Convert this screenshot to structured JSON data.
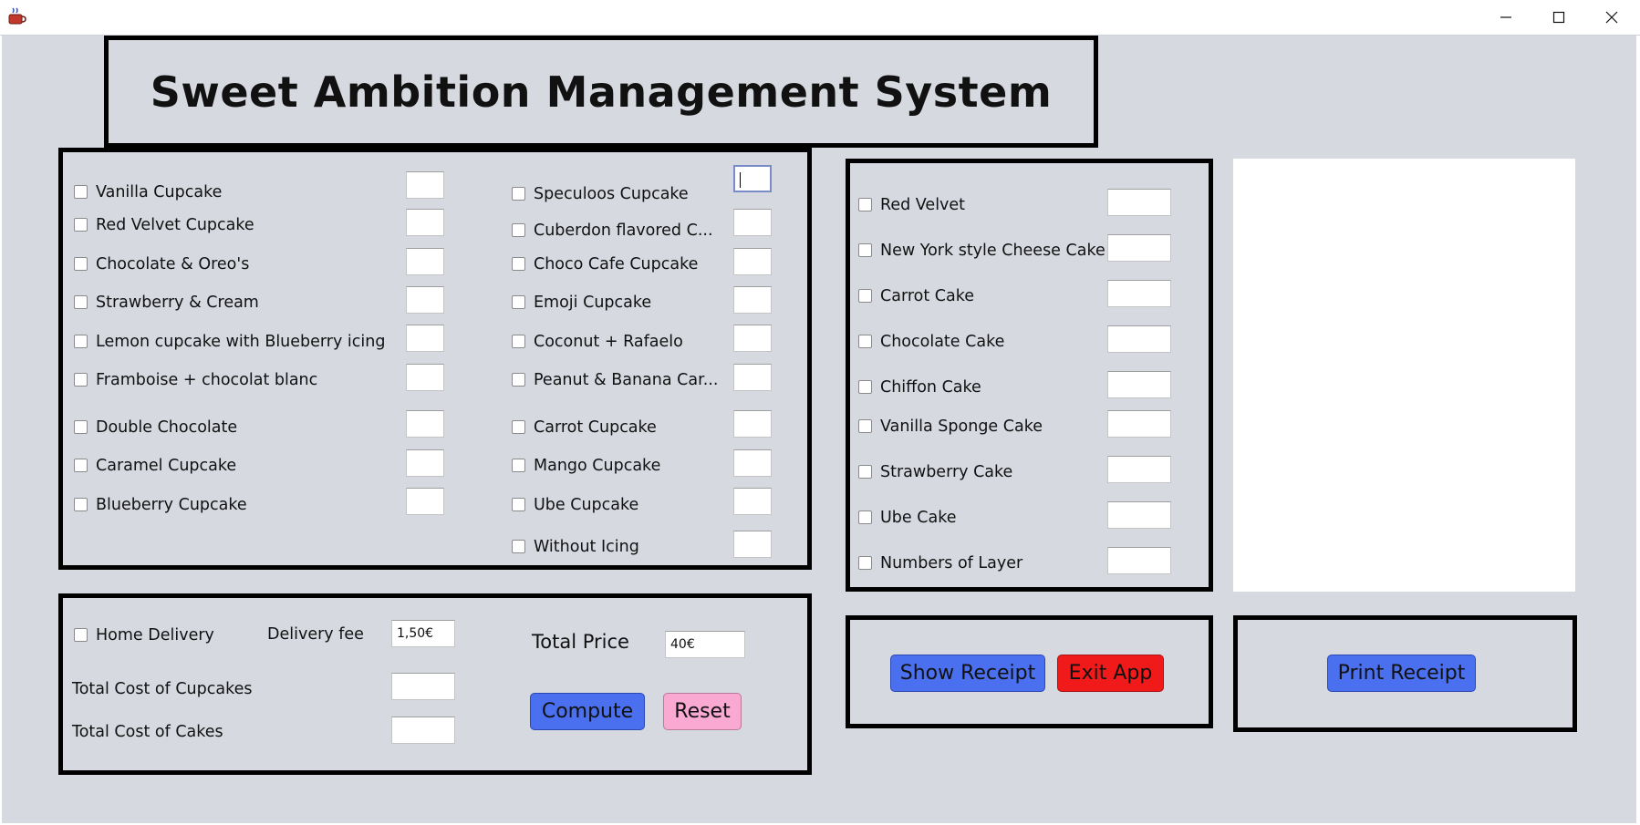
{
  "window": {
    "app_icon": "java-coffee-icon",
    "controls": [
      "minimize-icon",
      "maximize-icon",
      "close-icon"
    ]
  },
  "header": {
    "title": "Sweet Ambition Management System"
  },
  "cupcakes": {
    "left": [
      {
        "label": "Vanilla Cupcake",
        "qty": ""
      },
      {
        "label": "Red Velvet Cupcake",
        "qty": ""
      },
      {
        "label": "Chocolate & Oreo's",
        "qty": ""
      },
      {
        "label": "Strawberry & Cream",
        "qty": ""
      },
      {
        "label": "Lemon cupcake with Blueberry icing",
        "qty": ""
      },
      {
        "label": "Framboise + chocolat blanc",
        "qty": ""
      },
      {
        "label": "Double Chocolate",
        "qty": ""
      },
      {
        "label": "Caramel Cupcake",
        "qty": ""
      },
      {
        "label": "Blueberry Cupcake",
        "qty": ""
      }
    ],
    "right": [
      {
        "label": "Speculoos Cupcake",
        "qty": ""
      },
      {
        "label": "Cuberdon flavored C...",
        "qty": ""
      },
      {
        "label": "Choco Cafe Cupcake",
        "qty": ""
      },
      {
        "label": "Emoji Cupcake",
        "qty": ""
      },
      {
        "label": "Coconut + Rafaelo",
        "qty": ""
      },
      {
        "label": "Peanut & Banana Car...",
        "qty": ""
      },
      {
        "label": "Carrot Cupcake",
        "qty": ""
      },
      {
        "label": "Mango Cupcake",
        "qty": ""
      },
      {
        "label": "Ube Cupcake",
        "qty": ""
      },
      {
        "label": "Without Icing",
        "qty": ""
      }
    ]
  },
  "cakes": [
    {
      "label": "Red Velvet",
      "qty": ""
    },
    {
      "label": "New York style Cheese Cake",
      "qty": ""
    },
    {
      "label": "Carrot Cake",
      "qty": ""
    },
    {
      "label": "Chocolate Cake",
      "qty": ""
    },
    {
      "label": "Chiffon Cake",
      "qty": ""
    },
    {
      "label": "Vanilla Sponge Cake",
      "qty": ""
    },
    {
      "label": "Strawberry Cake",
      "qty": ""
    },
    {
      "label": "Ube Cake",
      "qty": ""
    },
    {
      "label": "Numbers of Layer",
      "qty": ""
    }
  ],
  "totals": {
    "home_delivery_label": "Home Delivery",
    "delivery_fee_label": "Delivery fee",
    "delivery_fee_value": "1,50€",
    "total_price_label": "Total Price",
    "total_price_value": "40€",
    "cupcakes_cost_label": "Total Cost of Cupcakes",
    "cupcakes_cost_value": "",
    "cakes_cost_label": "Total Cost of Cakes",
    "cakes_cost_value": ""
  },
  "buttons": {
    "compute": "Compute",
    "reset": "Reset",
    "show_receipt": "Show Receipt",
    "exit_app": "Exit App",
    "print_receipt": "Print Receipt"
  },
  "receipt": {
    "text": ""
  },
  "colors": {
    "background": "#d6d9e0",
    "blue_button": "#4a70f0",
    "red_button": "#f01a1a",
    "pink_button": "#f9a9d2"
  }
}
